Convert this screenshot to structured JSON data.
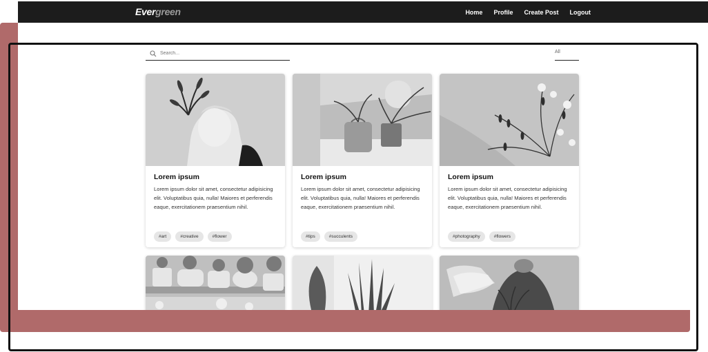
{
  "app": {
    "logo_part1": "Ever",
    "logo_part2": "green"
  },
  "nav": {
    "items": [
      "Home",
      "Profile",
      "Create Post",
      "Logout"
    ]
  },
  "search": {
    "placeholder": "Search..."
  },
  "filter": {
    "selected": "All"
  },
  "posts": [
    {
      "title": "Lorem ipsum",
      "body": "Lorem ipsum dolor sit amet, consectetur adipisicing elit. Voluptatibus quia, nulla! Maiores et perferendis eaque, exercitationem praesentium nihil.",
      "tags": [
        "#art",
        "#creative",
        "#flower"
      ],
      "image": "statue-with-plant"
    },
    {
      "title": "Lorem ipsum",
      "body": "Lorem ipsum dolor sit amet, consectetur adipisicing elit. Voluptatibus quia, nulla! Maiores et perferendis eaque, exercitationem praesentium nihil.",
      "tags": [
        "#tips",
        "#succulents"
      ],
      "image": "potted-plants-on-shelf"
    },
    {
      "title": "Lorem ipsum",
      "body": "Lorem ipsum dolor sit amet, consectetur adipisicing elit. Voluptatibus quia, nulla! Maiores et perferendis eaque, exercitationem praesentium nihil.",
      "tags": [
        "#photography",
        "#flowers"
      ],
      "image": "flower-bouquet"
    },
    {
      "image": "succulent-pots-row"
    },
    {
      "image": "snake-plant"
    },
    {
      "image": "watering-plant"
    }
  ],
  "colors": {
    "nav_bg": "#1c1c1c",
    "frame_accent": "#b06a6a",
    "tag_bg": "#e6e6e6"
  }
}
